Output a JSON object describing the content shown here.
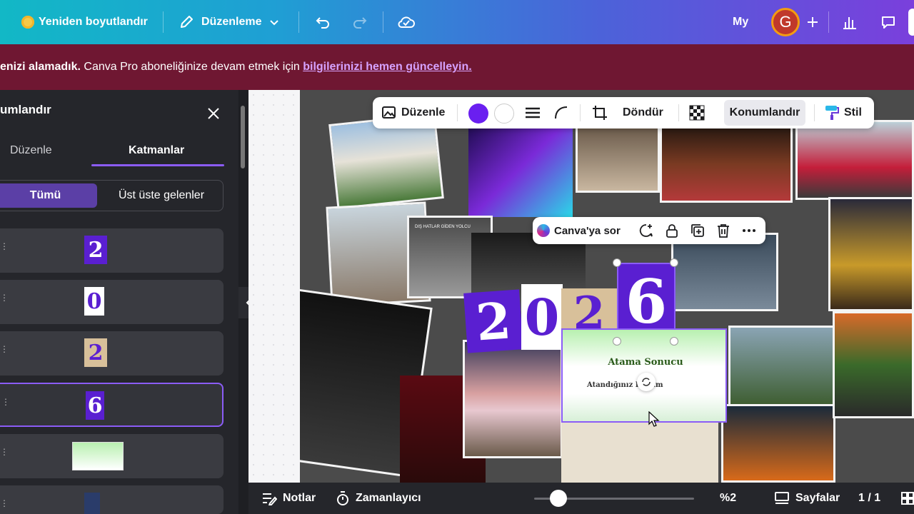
{
  "topbar": {
    "resize_label": "Yeniden boyutlandır",
    "edit_mode_label": "Düzenleme",
    "my_label": "My",
    "avatar_letter": "G"
  },
  "banner": {
    "bold_text": "enizi alamadık.",
    "text": " Canva Pro aboneliğinize devam etmek için ",
    "link_text": "bilgilerinizi hemen güncelleyin."
  },
  "panel": {
    "title": "umlandır",
    "tabs": {
      "edit": "Düzenle",
      "layers": "Katmanlar"
    },
    "filters": {
      "all": "Tümü",
      "overlapping": "Üst üste gelenler"
    },
    "layers": [
      {
        "glyph": "2",
        "bg": "#5a1fd1",
        "fg": "#ffffff"
      },
      {
        "glyph": "0",
        "bg": "#ffffff",
        "fg": "#5a1fd1"
      },
      {
        "glyph": "2",
        "bg": "#d8c09a",
        "fg": "#5a1fd1"
      },
      {
        "glyph": "6",
        "bg": "#5a1fd1",
        "fg": "#ffffff"
      }
    ]
  },
  "context_toolbar": {
    "edit_label": "Düzenle",
    "rotate_label": "Döndür",
    "position_label": "Konumlandır",
    "style_label": "Stil",
    "color1": "#6a1ff0",
    "color2": "#ffffff"
  },
  "mini_toolbar": {
    "ask_label": "Canva'ya sor"
  },
  "canvas": {
    "tiles": [
      "2",
      "0",
      "2",
      "6"
    ],
    "card_title": "Atama Sonucu",
    "card_text": "Atandığınız Kurum",
    "sign_text": "DIŞ HATLAR GİDEN YOLCU"
  },
  "bottombar": {
    "notes_label": "Notlar",
    "timer_label": "Zamanlayıcı",
    "zoom_label": "%2",
    "pages_label": "Sayfalar",
    "page_count": "1 / 1"
  }
}
